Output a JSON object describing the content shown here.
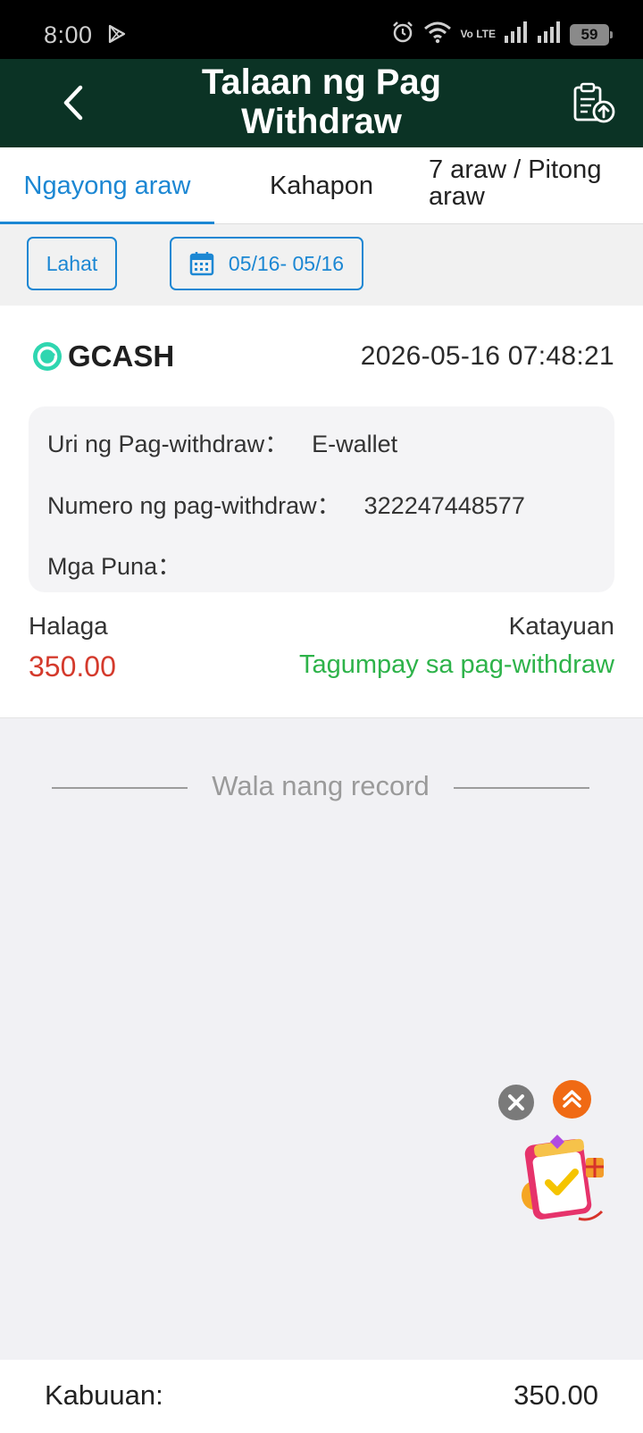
{
  "status_bar": {
    "time": "8:00",
    "network": "Vo LTE",
    "battery": "59"
  },
  "header": {
    "title": "Talaan ng Pag Withdraw"
  },
  "tabs": [
    {
      "label": "Ngayong araw",
      "active": true
    },
    {
      "label": "Kahapon",
      "active": false
    },
    {
      "label": "7 araw / Pitong araw",
      "active": false
    }
  ],
  "filters": {
    "all_label": "Lahat",
    "date_range": "05/16- 05/16"
  },
  "records": [
    {
      "method": "GCASH",
      "datetime": "2026-05-16 07:48:21",
      "type_label": "Uri ng Pag-withdraw：",
      "type_value": "E-wallet",
      "number_label": "Numero ng pag-withdraw：",
      "number_value": "322247448577",
      "remarks_label": "Mga Puna：",
      "remarks_value": "",
      "amount_label": "Halaga",
      "amount_value": "350.00",
      "status_label": "Katayuan",
      "status_value": "Tagumpay sa pag-withdraw"
    }
  ],
  "no_more_text": "Wala nang record",
  "footer": {
    "total_label": "Kabuuan:",
    "total_value": "350.00"
  },
  "colors": {
    "header_bg": "#0b3325",
    "accent": "#1c87d3",
    "amount": "#d43a2c",
    "success": "#2eb34a"
  }
}
